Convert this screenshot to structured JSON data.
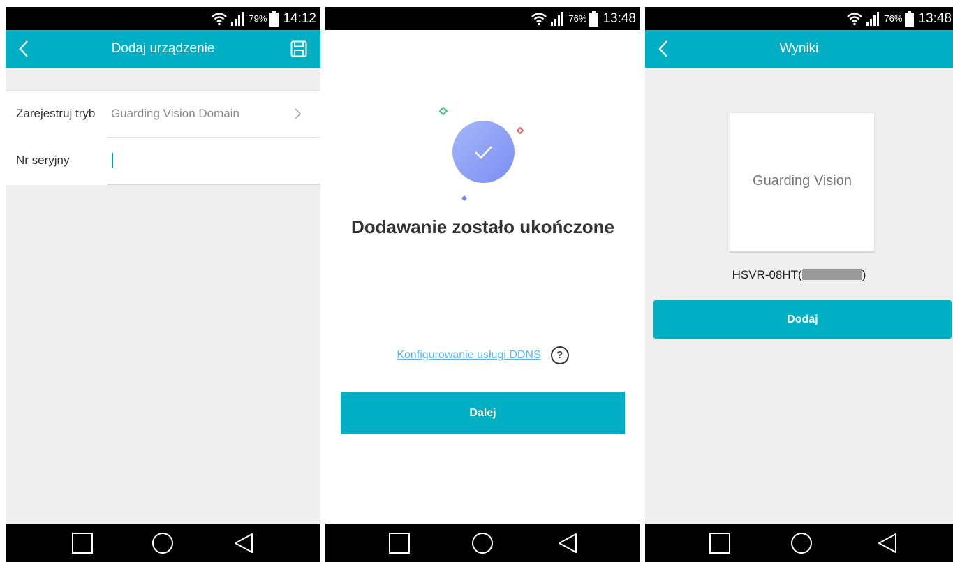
{
  "panels": [
    {
      "status": {
        "battery": "79%",
        "time": "14:12"
      },
      "appbar": {
        "title": "Dodaj urządzenie",
        "back_icon": "chevron-left-icon",
        "save_icon": "save-icon"
      },
      "form": {
        "register_mode_label": "Zarejestruj tryb",
        "register_mode_value": "Guarding Vision Domain",
        "serial_label": "Nr seryjny",
        "serial_value": ""
      }
    },
    {
      "status": {
        "battery": "76%",
        "time": "13:48"
      },
      "title": "Dodawanie zostało ukończone",
      "ddns_link": "Konfigurowanie usługi DDNS",
      "help_symbol": "?",
      "next_button": "Dalej"
    },
    {
      "status": {
        "battery": "76%",
        "time": "13:48"
      },
      "appbar": {
        "title": "Wyniki",
        "back_icon": "chevron-left-icon"
      },
      "device_brand": "Guarding Vision",
      "device_name_prefix": "HSVR-08HT(",
      "device_name_suffix": ")",
      "add_button": "Dodaj"
    }
  ],
  "colors": {
    "accent": "#00afc4",
    "link": "#5cb8e6",
    "check_gradient_start": "#a7b6fb",
    "check_gradient_end": "#7a8ef2"
  },
  "navbar_icons": [
    "recent-apps-icon",
    "home-icon",
    "back-icon"
  ]
}
